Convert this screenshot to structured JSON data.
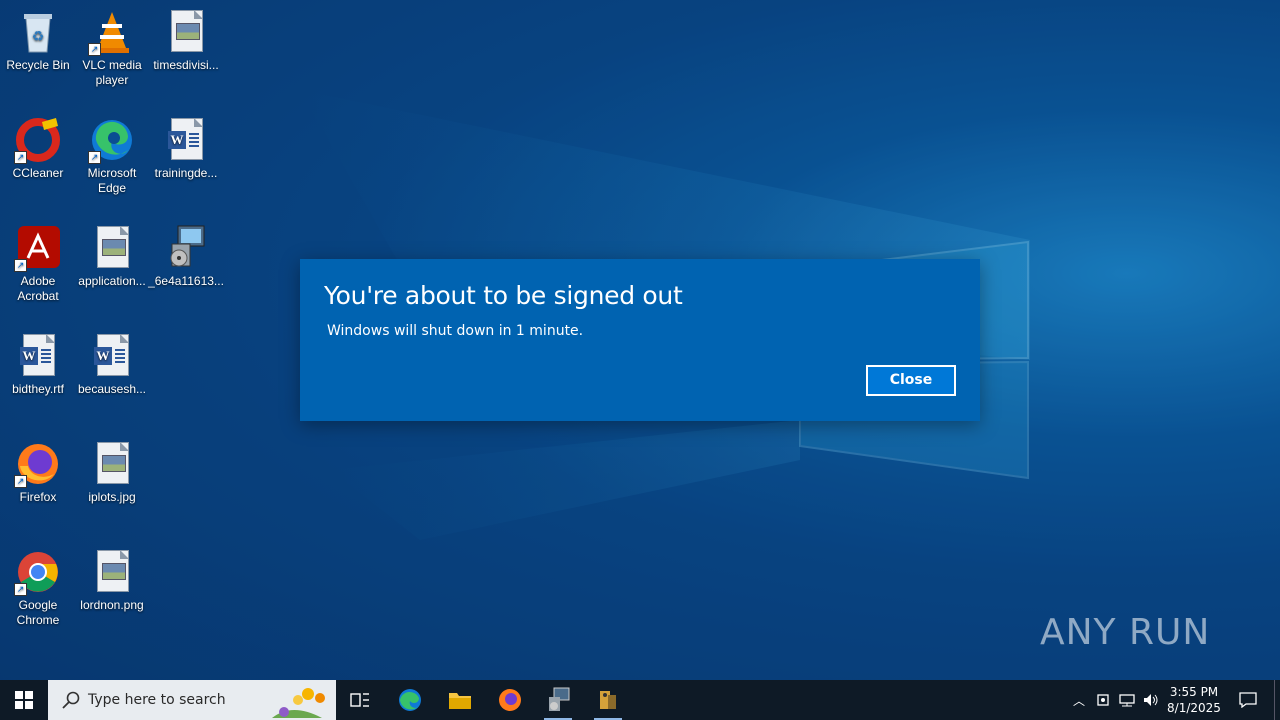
{
  "desktop": {
    "icons": [
      {
        "label": "Recycle Bin"
      },
      {
        "label": "VLC media player"
      },
      {
        "label": "timesdivisi..."
      },
      {
        "label": "CCleaner"
      },
      {
        "label": "Microsoft Edge"
      },
      {
        "label": "trainingde..."
      },
      {
        "label": "Adobe Acrobat"
      },
      {
        "label": "application..."
      },
      {
        "label": "_6e4a11613..."
      },
      {
        "label": "bidthey.rtf"
      },
      {
        "label": "becausesh..."
      },
      {
        "label": "Firefox"
      },
      {
        "label": "iplots.jpg"
      },
      {
        "label": "Google Chrome"
      },
      {
        "label": "lordnon.png"
      }
    ]
  },
  "dialog": {
    "title": "You're about to be signed out",
    "message": "Windows will shut down in 1 minute.",
    "close_label": "Close"
  },
  "watermark": {
    "text": "ANY RUN"
  },
  "taskbar": {
    "search_placeholder": "Type here to search",
    "clock_time": "3:55 PM",
    "clock_date": "8/1/2025"
  },
  "colors": {
    "dialog_bg": "#0063b1",
    "taskbar_bg": "#0e1a26",
    "desktop_accent": "#1e8fd8"
  }
}
